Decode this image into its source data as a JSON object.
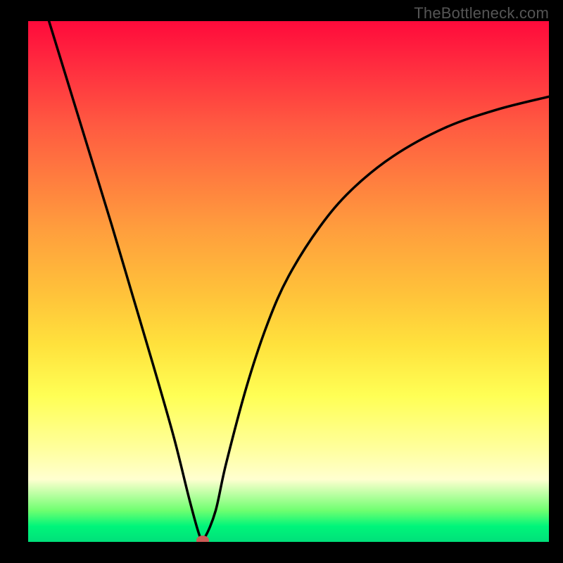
{
  "watermark": "TheBottleneck.com",
  "colors": {
    "marker": "#cc5a55",
    "curve": "#000000",
    "background": "#000000",
    "gradient_top": "#ff0a3b",
    "gradient_mid": "#ffe13c",
    "gradient_bottom": "#00e07a"
  },
  "chart_data": {
    "type": "line",
    "title": "",
    "xlabel": "",
    "ylabel": "",
    "note": "V-shaped bottleneck curve: steep left descent, minimum near x≈0.33, then asymptotic right ascent. Background gradient encodes red (high) to green (low).",
    "x_range": [
      0,
      1
    ],
    "y_range": [
      0,
      1
    ],
    "min_point": {
      "x": 0.335,
      "y": 0.0
    },
    "series": [
      {
        "name": "bottleneck-curve",
        "points": [
          {
            "x": 0.04,
            "y": 1.0
          },
          {
            "x": 0.08,
            "y": 0.87
          },
          {
            "x": 0.12,
            "y": 0.74
          },
          {
            "x": 0.16,
            "y": 0.61
          },
          {
            "x": 0.2,
            "y": 0.475
          },
          {
            "x": 0.24,
            "y": 0.34
          },
          {
            "x": 0.28,
            "y": 0.2
          },
          {
            "x": 0.31,
            "y": 0.08
          },
          {
            "x": 0.33,
            "y": 0.01
          },
          {
            "x": 0.34,
            "y": 0.01
          },
          {
            "x": 0.36,
            "y": 0.06
          },
          {
            "x": 0.38,
            "y": 0.15
          },
          {
            "x": 0.42,
            "y": 0.3
          },
          {
            "x": 0.46,
            "y": 0.42
          },
          {
            "x": 0.5,
            "y": 0.51
          },
          {
            "x": 0.56,
            "y": 0.605
          },
          {
            "x": 0.62,
            "y": 0.675
          },
          {
            "x": 0.7,
            "y": 0.74
          },
          {
            "x": 0.8,
            "y": 0.795
          },
          {
            "x": 0.9,
            "y": 0.83
          },
          {
            "x": 1.0,
            "y": 0.855
          }
        ]
      }
    ]
  }
}
